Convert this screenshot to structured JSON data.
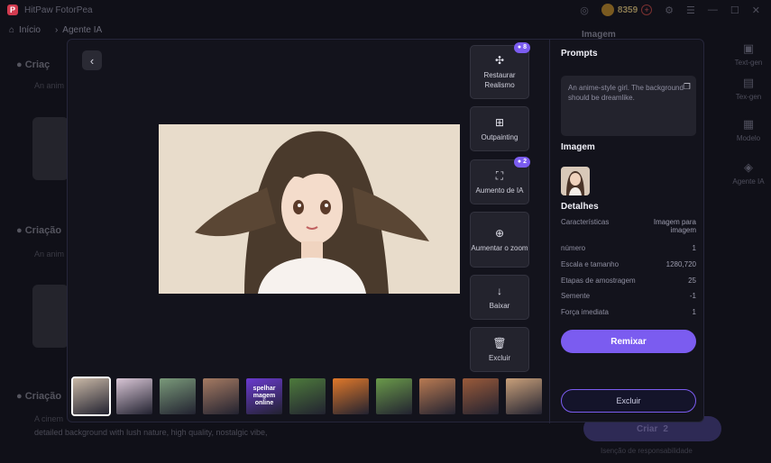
{
  "app": {
    "title": "HitPaw FotorPea"
  },
  "titlebar": {
    "coins": "8359"
  },
  "nav": {
    "home": "Início",
    "agent": "Agente IA"
  },
  "background": {
    "section1": "Criaç",
    "section1_sub": "An anim",
    "section2": "Criação",
    "section2_sub": "An anim",
    "section3": "Criação",
    "bottom_text1": "A cinem",
    "bottom_text2": "detailed background with lush nature, high quality, nostalgic vibe,",
    "right_label": "Imagem",
    "rail": [
      {
        "label": "Text-gen",
        "icon": "▣"
      },
      {
        "label": "Tex-gen",
        "icon": "▤"
      },
      {
        "label": "Modelo",
        "icon": "▦"
      },
      {
        "label": "Agente IA",
        "icon": "◈"
      }
    ],
    "create_label": "Criar",
    "create_cost": "2",
    "disclaimer": "Isenção de responsabilidade"
  },
  "tools": [
    {
      "label": "Restaurar Realismo",
      "icon": "✣",
      "badge": "8"
    },
    {
      "label": "Outpainting",
      "icon": "⊞",
      "badge": ""
    },
    {
      "label": "Aumento de IA",
      "icon": "⛶",
      "badge": "2"
    },
    {
      "label": "Aumentar o zoom",
      "icon": "⊕",
      "badge": ""
    },
    {
      "label": "Baixar",
      "icon": "↓",
      "badge": ""
    },
    {
      "label": "Excluir",
      "icon": "🗑",
      "badge": ""
    }
  ],
  "thumbs": [
    {
      "label": "",
      "color": "#c9b8a6"
    },
    {
      "label": "",
      "color": "#d9c6d6"
    },
    {
      "label": "",
      "color": "#7a9a7a"
    },
    {
      "label": "",
      "color": "#a57a62"
    },
    {
      "label": "spelhar magem online",
      "color": "#6a3ad0"
    },
    {
      "label": "",
      "color": "#4d7a3c"
    },
    {
      "label": "",
      "color": "#e0782a"
    },
    {
      "label": "",
      "color": "#6a9a4a"
    },
    {
      "label": "",
      "color": "#b97a52"
    },
    {
      "label": "",
      "color": "#9a5a3a"
    },
    {
      "label": "",
      "color": "#c9a07a"
    }
  ],
  "panel": {
    "prompts_heading": "Prompts",
    "prompt_text": "An anime-style girl. The background should be dreamlike.",
    "image_heading": "Imagem",
    "details_heading": "Detalhes",
    "details": [
      {
        "k": "Características",
        "v": "Imagem para imagem"
      },
      {
        "k": "número",
        "v": "1"
      },
      {
        "k": "Escala e tamanho",
        "v": "1280,720"
      },
      {
        "k": "Etapas de amostragem",
        "v": "25"
      },
      {
        "k": "Semente",
        "v": "-1"
      },
      {
        "k": "Força imediata",
        "v": "1"
      }
    ],
    "remix_label": "Remixar",
    "delete_label": "Excluir"
  }
}
